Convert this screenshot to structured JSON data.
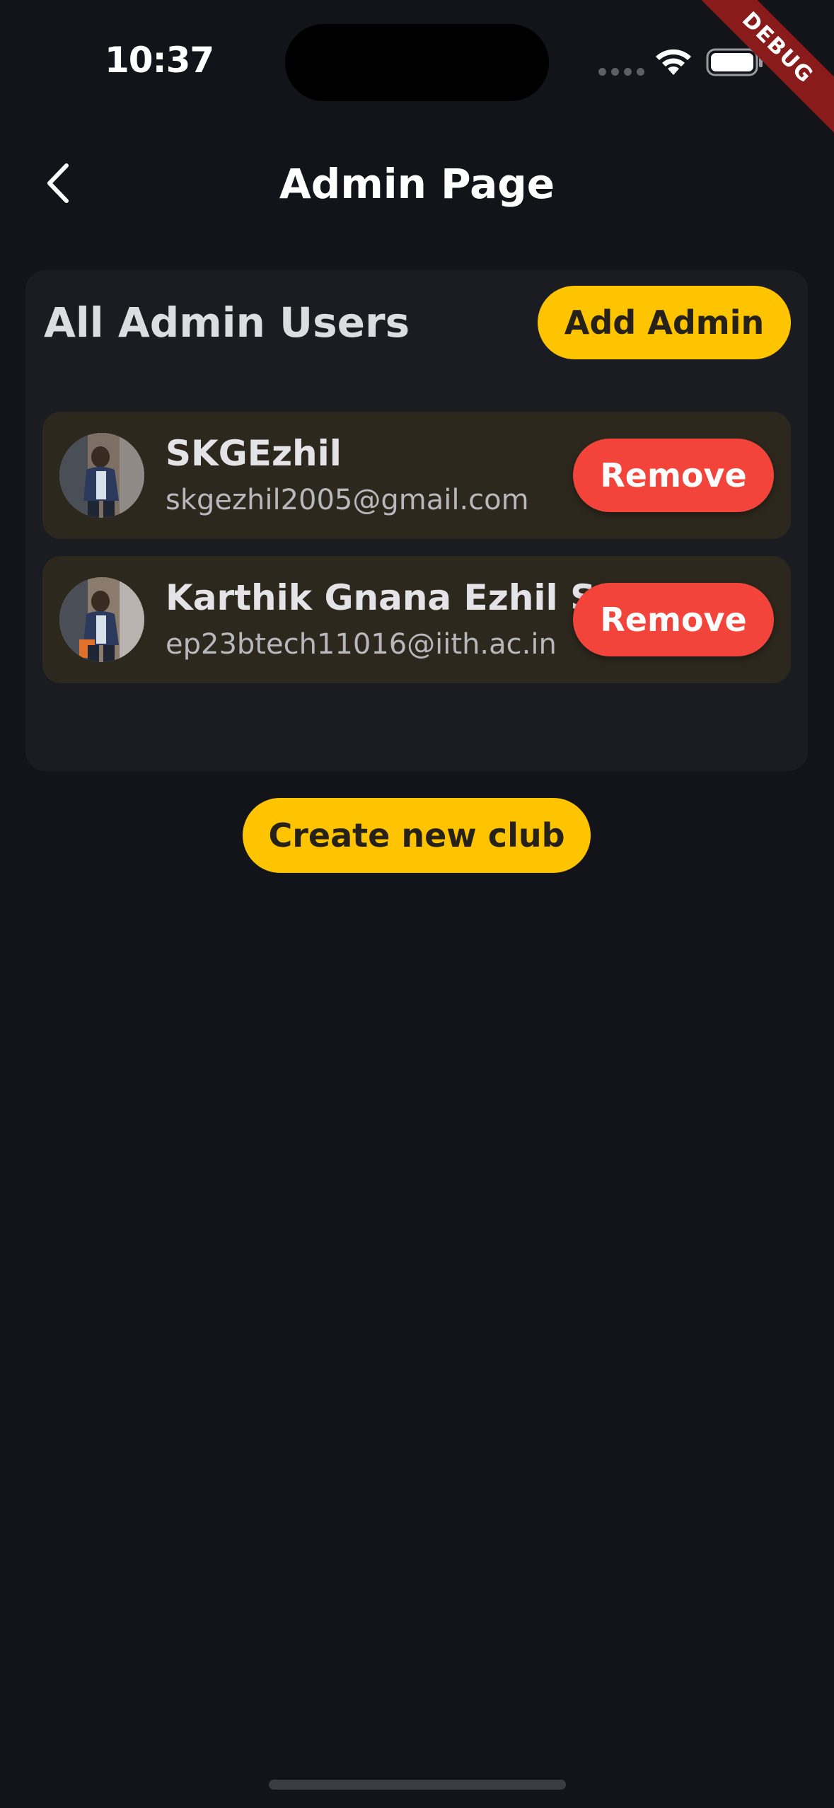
{
  "status_bar": {
    "time": "10:37",
    "debug_banner": "DEBUG"
  },
  "app_bar": {
    "title": "Admin Page",
    "back_icon": "chevron-left-icon"
  },
  "admin_card": {
    "heading": "All Admin Users",
    "add_button_label": "Add Admin",
    "users": [
      {
        "name": "SKGEzhil",
        "email": "skgezhil2005@gmail.com",
        "remove_label": "Remove"
      },
      {
        "name": "Karthik Gnana Ezhil S",
        "email": "ep23btech11016@iith.ac.in",
        "remove_label": "Remove"
      }
    ]
  },
  "create_club_label": "Create new club",
  "colors": {
    "background": "#121419",
    "card": "#1a1c21",
    "row": "#2c281d",
    "accent_yellow": "#ffc400",
    "danger_red": "#f2443a"
  }
}
